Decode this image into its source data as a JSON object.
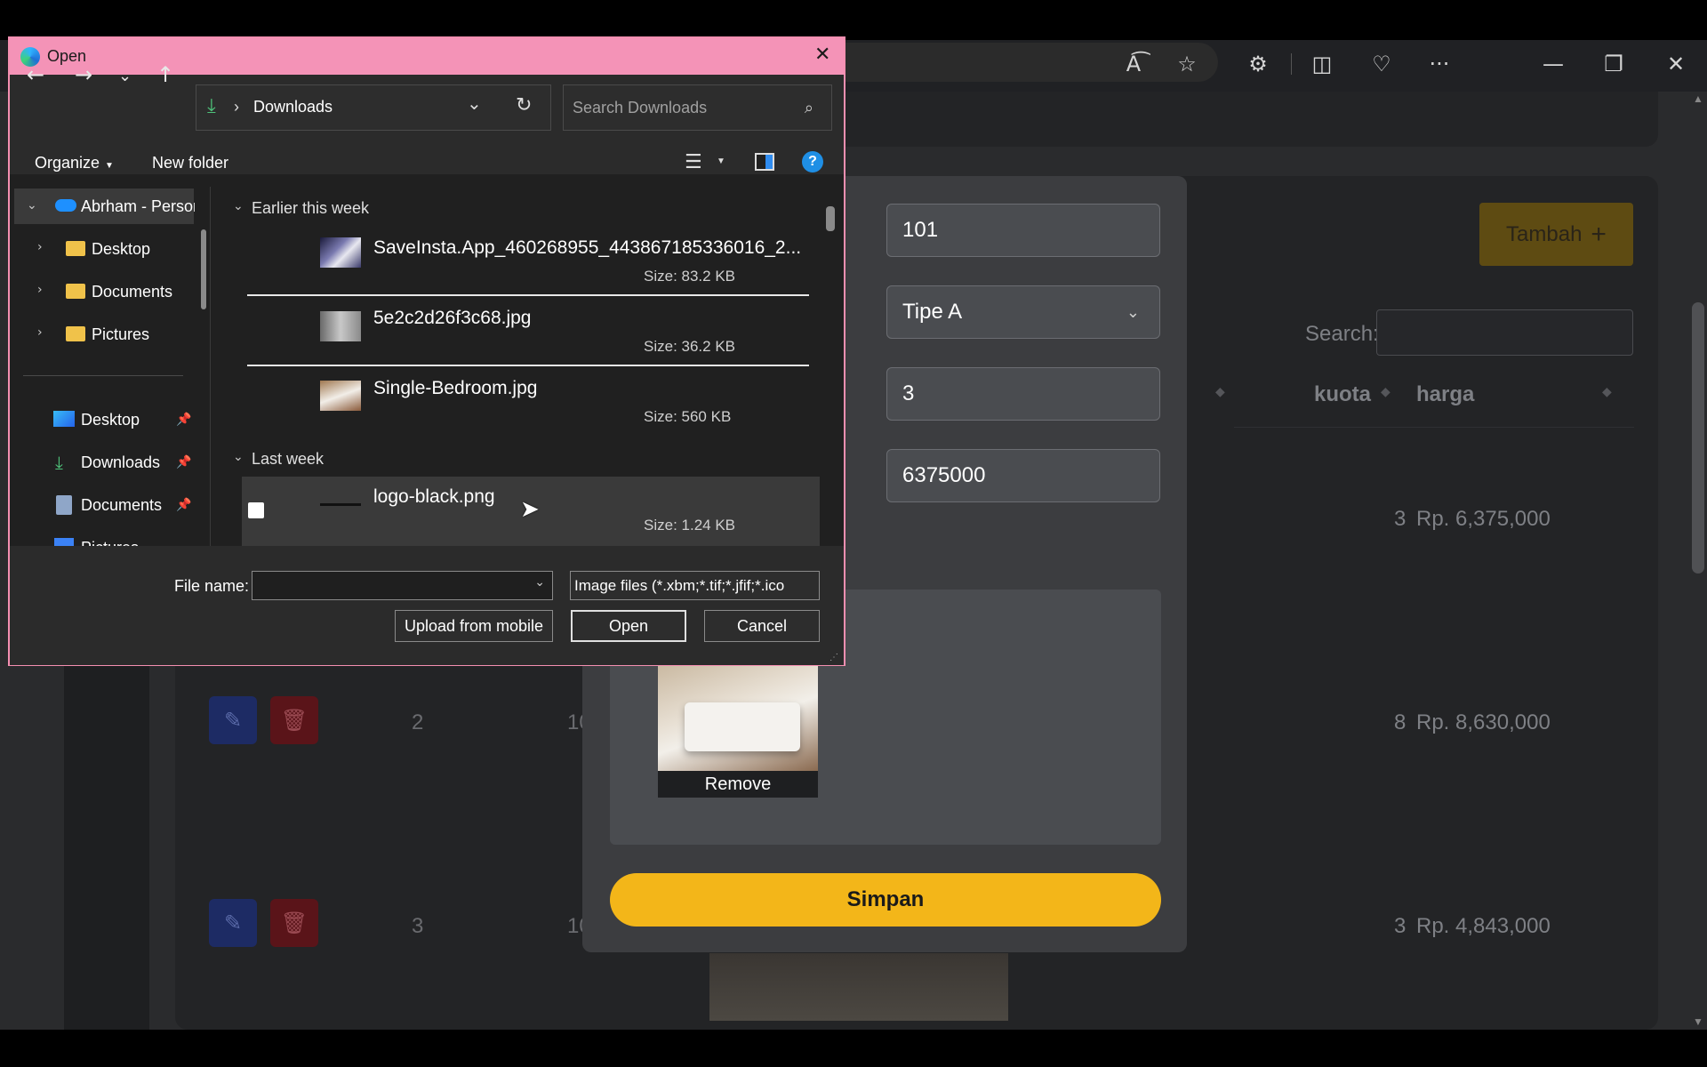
{
  "browser": {
    "read_aloud_icon": "read-aloud-icon",
    "more_label": "···"
  },
  "form": {
    "room_number": "101",
    "room_type": "Tipe A",
    "quota": "3",
    "price": "6375000",
    "remove_label": "Remove",
    "save_label": "Simpan"
  },
  "table": {
    "add_label": "Tambah",
    "search_label": "Search:",
    "columns": [
      "kuota",
      "harga"
    ],
    "rows": [
      {
        "no": "",
        "kuota": "3",
        "harga": "Rp. 6,375,000"
      },
      {
        "no": "2",
        "room": "10",
        "kuota": "8",
        "harga": "Rp. 8,630,000"
      },
      {
        "no": "3",
        "room": "10",
        "kuota": "3",
        "harga": "Rp. 4,843,000"
      }
    ]
  },
  "dialog": {
    "title": "Open",
    "path": "Downloads",
    "search_placeholder": "Search Downloads",
    "organize_label": "Organize",
    "new_folder_label": "New folder",
    "nav": {
      "onedrive": "Abrham - Person",
      "tree": [
        "Desktop",
        "Documents",
        "Pictures"
      ],
      "quick": [
        "Desktop",
        "Downloads",
        "Documents",
        "Pictures"
      ]
    },
    "groups": [
      "Earlier this week",
      "Last week"
    ],
    "files": [
      {
        "name": "SaveInsta.App_460268955_443867185336016_2...",
        "size": "Size: 83.2 KB"
      },
      {
        "name": "5e2c2d26f3c68.jpg",
        "size": "Size: 36.2 KB"
      },
      {
        "name": "Single-Bedroom.jpg",
        "size": "Size: 560 KB"
      },
      {
        "name": "logo-black.png",
        "size": "Size: 1.24 KB"
      }
    ],
    "file_name_label": "File name:",
    "file_name_value": "",
    "file_type": "Image files (*.xbm;*.tif;*.jfif;*.ico",
    "upload_mobile_label": "Upload from mobile",
    "open_label": "Open",
    "cancel_label": "Cancel"
  }
}
